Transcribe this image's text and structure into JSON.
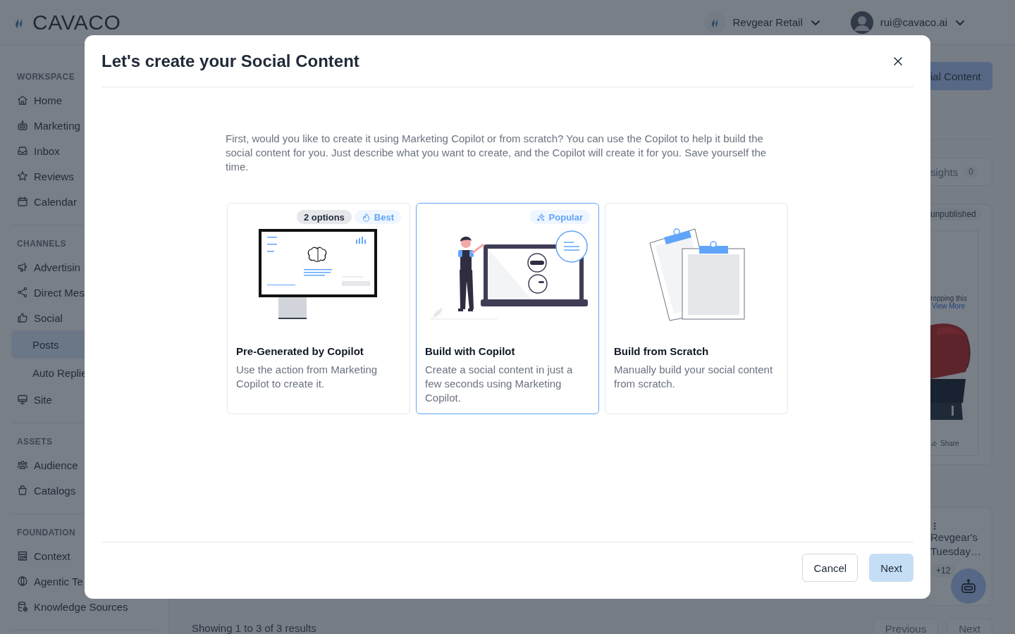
{
  "header": {
    "logo": "CAVACO",
    "workspace": "Revgear Retail",
    "user": "rui@cavaco.ai"
  },
  "sidebar": {
    "sections": [
      {
        "label": "WORKSPACE",
        "items": [
          {
            "label": "Home",
            "selected": false
          },
          {
            "label": "Marketing",
            "selected": false
          },
          {
            "label": "Inbox",
            "selected": false
          },
          {
            "label": "Reviews",
            "selected": false
          },
          {
            "label": "Calendar",
            "selected": false
          }
        ]
      },
      {
        "label": "CHANNELS",
        "items": [
          {
            "label": "Advertisin",
            "selected": false
          },
          {
            "label": "Direct Mes",
            "selected": false
          },
          {
            "label": "Social",
            "selected": false,
            "children": [
              {
                "label": "Posts",
                "selected": true
              },
              {
                "label": "Auto Replie",
                "selected": false
              }
            ]
          },
          {
            "label": "Site",
            "selected": false
          }
        ]
      },
      {
        "label": "ASSETS",
        "items": [
          {
            "label": "Audience",
            "selected": false
          },
          {
            "label": "Catalogs",
            "selected": false
          }
        ]
      },
      {
        "label": "FOUNDATION",
        "items": [
          {
            "label": "Context",
            "selected": false
          },
          {
            "label": "Agentic Te",
            "selected": false
          },
          {
            "label": "Knowledge Sources",
            "selected": false
          }
        ]
      }
    ]
  },
  "background": {
    "create_button": "ial Content",
    "insights_tab": {
      "label": "sights",
      "count": "0"
    },
    "post_card": {
      "status": "unpublished",
      "text": "ropping this",
      "link": "View More",
      "action": "Share"
    },
    "post_card_2": {
      "title_lines": [
        "Revgear's",
        "Tuesday…"
      ],
      "more_tags": "+12"
    },
    "results": "Showing 1 to 3 of 3 results",
    "pagination": [
      "Previous",
      "Next"
    ]
  },
  "dialog": {
    "title": "Let's create your Social Content",
    "intro": "First, would you like to create it using Marketing Copilot or from scratch? You can use the Copilot to help it build the social content for you. Just describe what you want to create, and the Copilot will create it for you. Save yourself the time.",
    "options": [
      {
        "title": "Pre-Generated by Copilot",
        "description": "Use the action from Marketing Copilot to create it.",
        "selected": false,
        "badges": [
          {
            "label": "2 options",
            "kind": "count"
          },
          {
            "label": "Best",
            "kind": "tag"
          }
        ]
      },
      {
        "title": "Build with Copilot",
        "description": "Create a social content in just a few seconds using Marketing Copilot.",
        "selected": true,
        "badges": [
          {
            "label": "Popular",
            "kind": "tag"
          }
        ]
      },
      {
        "title": "Build from Scratch",
        "description": "Manually build your social content from scratch.",
        "selected": false
      }
    ],
    "buttons": [
      {
        "label": "Cancel",
        "kind": "secondary"
      },
      {
        "label": "Next",
        "kind": "primary",
        "disabled": true
      }
    ]
  }
}
